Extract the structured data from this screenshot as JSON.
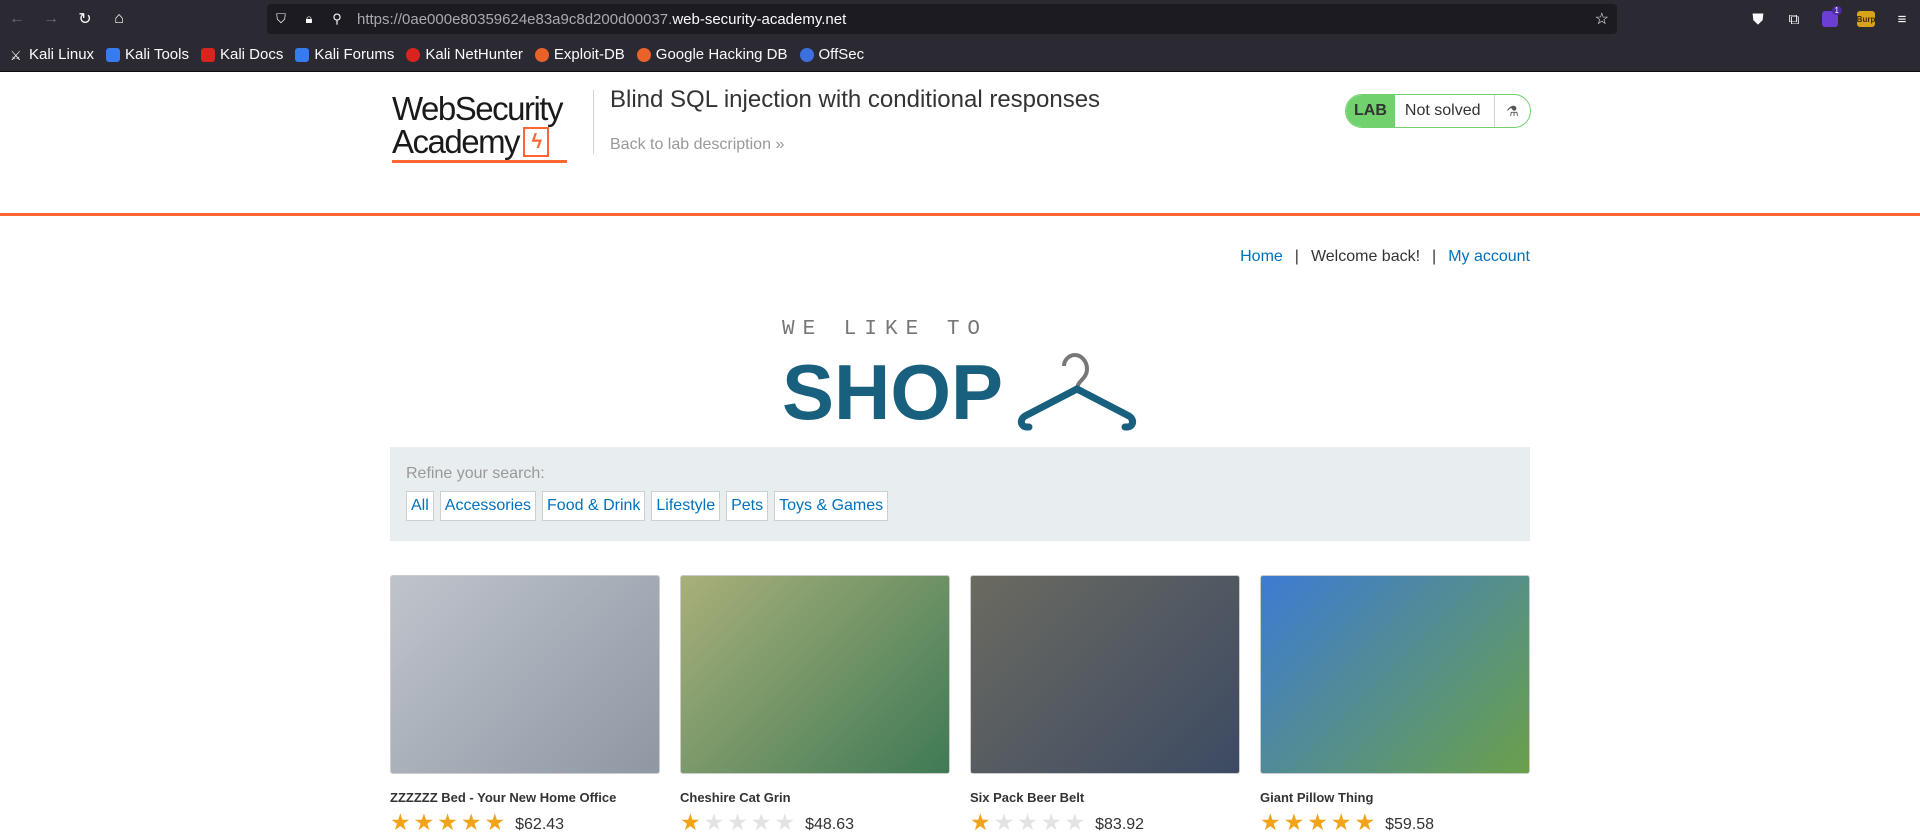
{
  "browser": {
    "url_prefix": "https://0ae000e80359624e83a9c8d200d00037.",
    "url_domain": "web-security-academy.net",
    "bookmarks": [
      {
        "label": "Kali Linux",
        "color": "#367bf0"
      },
      {
        "label": "Kali Tools",
        "color": "#367bf0"
      },
      {
        "label": "Kali Docs",
        "color": "#d9241e"
      },
      {
        "label": "Kali Forums",
        "color": "#367bf0"
      },
      {
        "label": "Kali NetHunter",
        "color": "#d9241e"
      },
      {
        "label": "Exploit-DB",
        "color": "#e9622a"
      },
      {
        "label": "Google Hacking DB",
        "color": "#e9622a"
      },
      {
        "label": "OffSec",
        "color": "#3c6fe0"
      }
    ],
    "extension_badge": "1",
    "burp_label": "Burp"
  },
  "lab": {
    "logo_line1": "WebSecurity",
    "logo_line2": "Academy",
    "title": "Blind SQL injection with conditional responses",
    "back_link": "Back to lab description",
    "back_chevron": "»",
    "status_pill": "LAB",
    "status_text": "Not solved"
  },
  "nav": {
    "home": "Home",
    "sep1": "|",
    "welcome": "Welcome back!",
    "sep2": "|",
    "account": "My account"
  },
  "banner": {
    "tagline": "WE LIKE TO",
    "shop": "SHOP"
  },
  "filters": {
    "label": "Refine your search:",
    "items": [
      "All",
      "Accessories",
      "Food & Drink",
      "Lifestyle",
      "Pets",
      "Toys & Games"
    ]
  },
  "products": [
    {
      "name": "ZZZZZZ Bed - Your New Home Office",
      "price": "$62.43",
      "rating": 5,
      "image_colors": [
        "#bfc4cc",
        "#8f97a3"
      ]
    },
    {
      "name": "Cheshire Cat Grin",
      "price": "$48.63",
      "rating": 1,
      "image_colors": [
        "#a9b07a",
        "#3f7a55"
      ]
    },
    {
      "name": "Six Pack Beer Belt",
      "price": "$83.92",
      "rating": 1,
      "image_colors": [
        "#6b6a60",
        "#3c4a63"
      ]
    },
    {
      "name": "Giant Pillow Thing",
      "price": "$59.58",
      "rating": 5,
      "image_colors": [
        "#3d7bd4",
        "#6aa04a"
      ]
    }
  ]
}
